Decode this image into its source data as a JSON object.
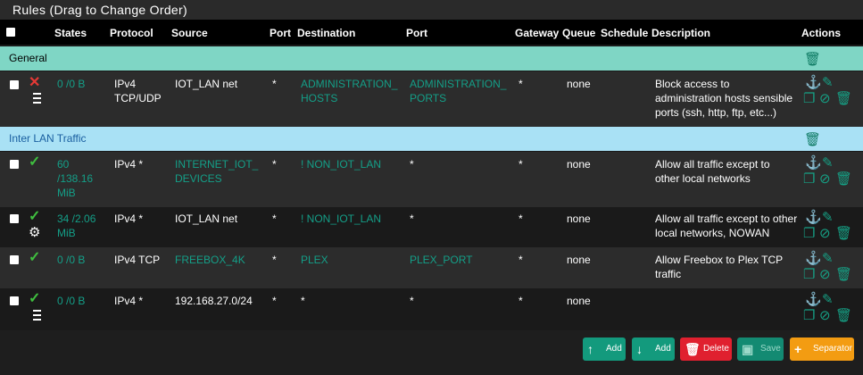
{
  "panel": {
    "title": "Rules (Drag to Change Order)"
  },
  "columns": [
    "States",
    "Protocol",
    "Source",
    "Port",
    "Destination",
    "Port",
    "Gateway",
    "Queue",
    "Schedule",
    "Description",
    "Actions"
  ],
  "separators": {
    "general": "General",
    "inter": "Inter LAN Traffic"
  },
  "rules": [
    {
      "states": "0 /0 B",
      "protocol": "IPv4 TCP/UDP",
      "source": "IOT_LAN net",
      "sport": "*",
      "dest": "ADMINISTRATION_ HOSTS",
      "dport": "ADMINISTRATION_ PORTS",
      "gateway": "*",
      "queue": "none",
      "desc": "Block access to administration hosts sensible ports (ssh, http, ftp, etc...)"
    },
    {
      "states": "60 /138.16 MiB",
      "protocol": "IPv4 *",
      "source": "INTERNET_IOT_ DEVICES",
      "sport": "*",
      "dest": "! NON_IOT_LAN",
      "dport": "*",
      "gateway": "*",
      "queue": "none",
      "desc": "Allow all traffic except to other local networks"
    },
    {
      "states": "34 /2.06 MiB",
      "protocol": "IPv4 *",
      "source": "IOT_LAN net",
      "sport": "*",
      "dest": "! NON_IOT_LAN",
      "dport": "*",
      "gateway": "*",
      "queue": "none",
      "desc": "Allow all traffic except to other local networks, NOWAN"
    },
    {
      "states": "0 /0 B",
      "protocol": "IPv4 TCP",
      "source": "FREEBOX_4K",
      "sport": "*",
      "dest": "PLEX",
      "dport": "PLEX_PORT",
      "gateway": "*",
      "queue": "none",
      "desc": "Allow Freebox to Plex TCP traffic"
    },
    {
      "states": "0 /0 B",
      "protocol": "IPv4 *",
      "source": "192.168.27.0/24",
      "sport": "*",
      "dest": "*",
      "dport": "*",
      "gateway": "*",
      "queue": "none",
      "desc": ""
    }
  ],
  "buttons": {
    "add_top": "Add",
    "add_bottom": "Add",
    "delete": "Delete",
    "save": "Save",
    "separator": "Separator"
  },
  "colors": {
    "teal": "#149f88",
    "green": "#3fbf3f",
    "red": "#e53935",
    "general_bg": "#7fd6c5",
    "inter_bg": "#a9e1f5",
    "add_btn": "#139a7d",
    "delete_btn": "#e0202f",
    "save_btn": "#138a72",
    "separator_btn": "#f39c12"
  },
  "icons": [
    "anchor-icon",
    "pencil-icon",
    "copy-icon",
    "ban-icon",
    "trash-icon",
    "check-icon",
    "x-icon",
    "list-icon",
    "gear-icon"
  ]
}
